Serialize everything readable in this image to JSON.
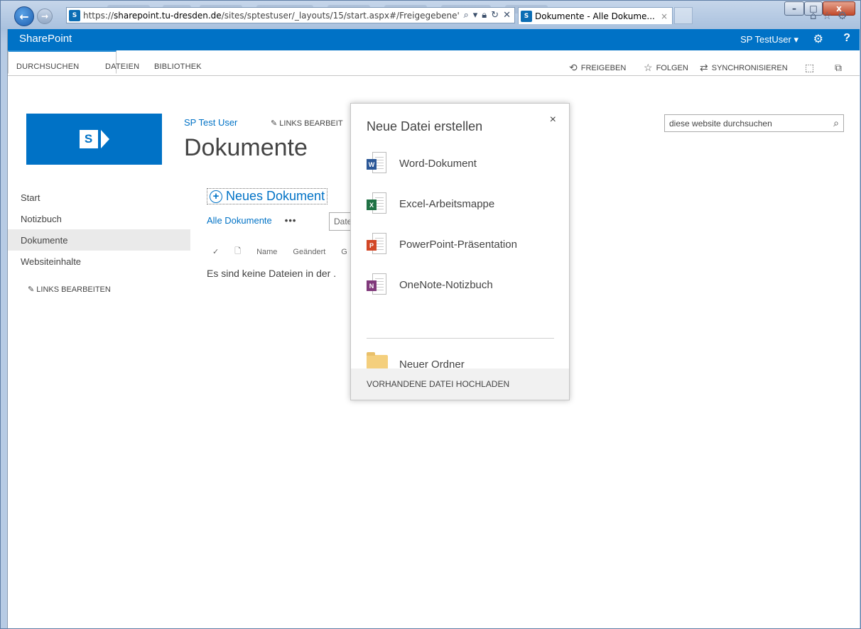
{
  "browser": {
    "address": {
      "protocol": "https://",
      "host": "sharepoint.tu-dresden.de",
      "path": "/sites/sptestuser/_layouts/15/start.aspx#/Freigegebene' "
    },
    "tab": {
      "title": "Dokumente - Alle Dokume...",
      "close": "×"
    },
    "window_buttons": {
      "minimize": "–",
      "maximize": "□",
      "close": "x"
    }
  },
  "suitebar": {
    "brand": "SharePoint",
    "user": "SP TestUser ▾",
    "gear_icon": "⚙",
    "help": "?"
  },
  "ribbon": {
    "tabs": [
      "DURCHSUCHEN",
      "DATEIEN",
      "BIBLIOTHEK"
    ],
    "actions": {
      "share": "FREIGEBEN",
      "follow": "FOLGEN",
      "sync": "SYNCHRONISIEREN"
    }
  },
  "site": {
    "name": "SP Test User",
    "edit_links": "LINKS BEARBEIT",
    "page_title": "Dokumente"
  },
  "search": {
    "placeholder": "diese website durchsuchen"
  },
  "leftnav": {
    "items": [
      "Start",
      "Notizbuch",
      "Dokumente",
      "Websiteinhalte"
    ],
    "selected": "Dokumente",
    "edit_links": "LINKS BEARBEITEN"
  },
  "main": {
    "new_document": "Neues Dokument",
    "view_all": "Alle Dokumente",
    "view_more": "•••",
    "filter_text": "Date",
    "columns": [
      "Name",
      "Geändert",
      "G"
    ],
    "empty_message": "Es sind keine Dateien in der ."
  },
  "callout": {
    "title": "Neue Datei erstellen",
    "close": "×",
    "items": [
      {
        "label": "Word-Dokument",
        "badge": "W",
        "color": "#2b5797"
      },
      {
        "label": "Excel-Arbeitsmappe",
        "badge": "X",
        "color": "#207245"
      },
      {
        "label": "PowerPoint-Präsentation",
        "badge": "P",
        "color": "#d24726"
      },
      {
        "label": "OneNote-Notizbuch",
        "badge": "N",
        "color": "#80397b"
      }
    ],
    "folder": "Neuer Ordner",
    "upload": "VORHANDENE DATEI HOCHLADEN"
  },
  "colors": {
    "brand_blue": "#0072c6",
    "folder": "#f4cf7d"
  }
}
